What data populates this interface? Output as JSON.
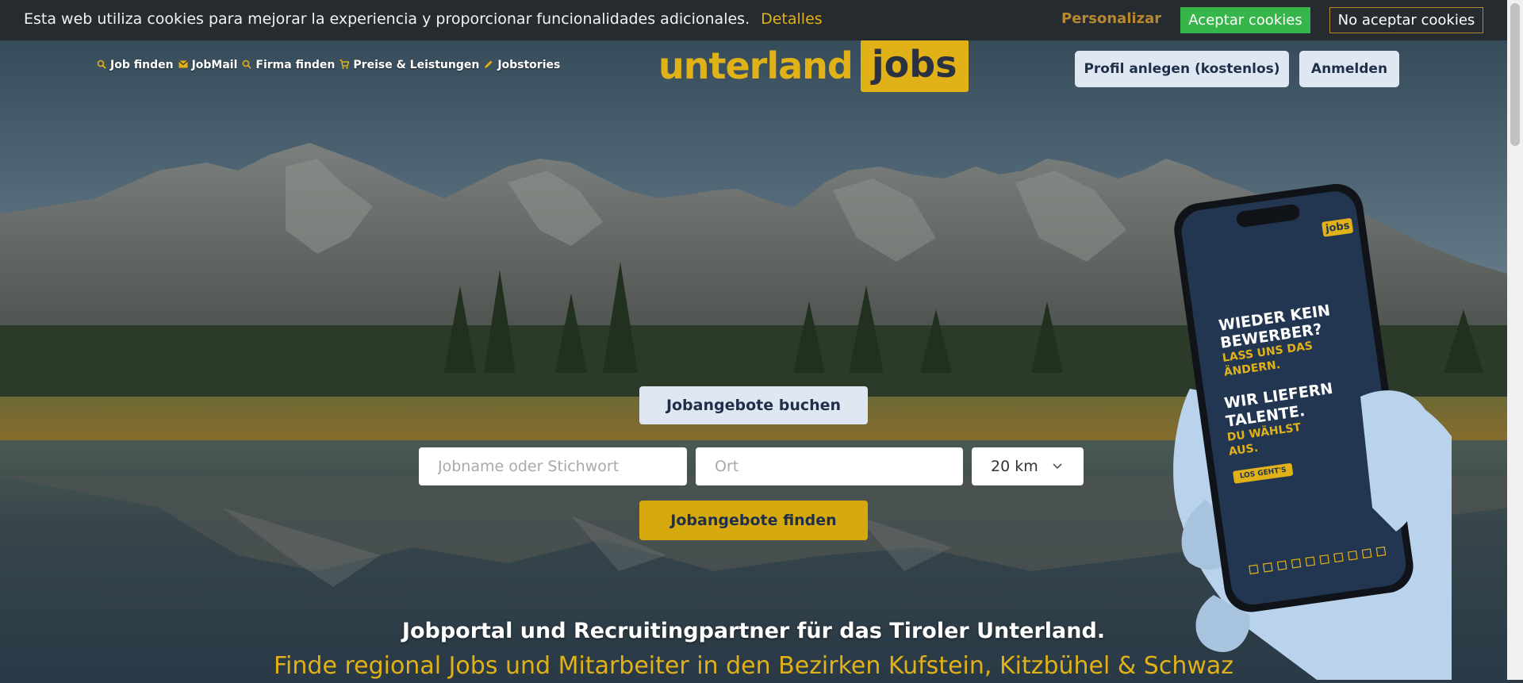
{
  "cookie": {
    "message": "Esta web utiliza cookies para mejorar la experiencia y proporcionar funcionalidades adicionales.",
    "details_label": "Detalles",
    "personalize_label": "Personalizar",
    "accept_label": "Aceptar cookies",
    "reject_label": "No aceptar cookies"
  },
  "nav": {
    "items": [
      {
        "label": "Job finden",
        "icon": "search-icon"
      },
      {
        "label": "JobMail",
        "icon": "mail-icon"
      },
      {
        "label": "Firma finden",
        "icon": "search-icon"
      },
      {
        "label": "Preise & Leistungen",
        "icon": "cart-icon"
      },
      {
        "label": "Jobstories",
        "icon": "pencil-icon"
      }
    ]
  },
  "logo": {
    "left": "unterland",
    "right": "jobs"
  },
  "header": {
    "profile_label": "Profil anlegen (kostenlos)",
    "login_label": "Anmelden"
  },
  "search": {
    "book_label": "Jobangebote buchen",
    "job_placeholder": "Jobname oder Stichwort",
    "job_value": "",
    "location_placeholder": "Ort",
    "location_value": "",
    "radius_value": "20 km",
    "submit_label": "Jobangebote finden"
  },
  "tagline": {
    "headline": "Jobportal und Recruitingpartner für das Tiroler Unterland.",
    "subline": "Finde regional Jobs und Mitarbeiter in den Bezirken Kufstein, Kitzbühel & Schwaz"
  },
  "phone": {
    "badge": "jobs",
    "line1": "WIEDER KEIN",
    "line2": "BEWERBER?",
    "line3": "LASS UNS DAS",
    "line4": "ÄNDERN.",
    "line5": "WIR LIEFERN",
    "line6": "TALENTE.",
    "line7": "DU WÄHLST",
    "line8": "AUS.",
    "cta": "LOS GEHT'S"
  },
  "colors": {
    "accent": "#e1b217",
    "cookie_bar": "#262b2f",
    "accept_green": "#36b64a",
    "button_light": "#dfe7f2",
    "text_dark": "#1f2f49"
  }
}
